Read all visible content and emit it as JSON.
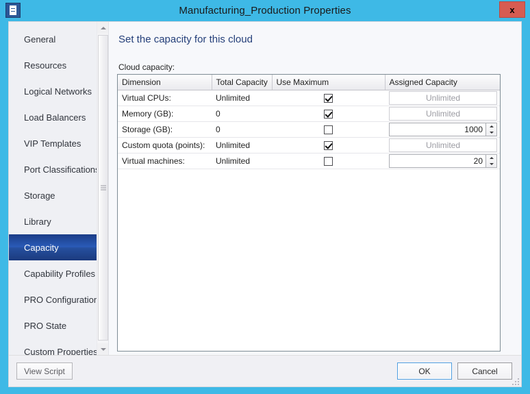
{
  "window": {
    "title": "Manufacturing_Production Properties",
    "icon": "properties-icon",
    "close_label": "x"
  },
  "sidebar": {
    "items": [
      {
        "label": "General",
        "selected": false
      },
      {
        "label": "Resources",
        "selected": false
      },
      {
        "label": "Logical Networks",
        "selected": false
      },
      {
        "label": "Load Balancers",
        "selected": false
      },
      {
        "label": "VIP Templates",
        "selected": false
      },
      {
        "label": "Port Classifications",
        "selected": false
      },
      {
        "label": "Storage",
        "selected": false
      },
      {
        "label": "Library",
        "selected": false
      },
      {
        "label": "Capacity",
        "selected": true
      },
      {
        "label": "Capability Profiles",
        "selected": false
      },
      {
        "label": "PRO Configuration",
        "selected": false
      },
      {
        "label": "PRO State",
        "selected": false
      },
      {
        "label": "Custom Properties",
        "selected": false
      }
    ]
  },
  "content": {
    "page_title": "Set the capacity for this cloud",
    "field_label": "Cloud capacity:",
    "table": {
      "columns": [
        "Dimension",
        "Total Capacity",
        "Use Maximum",
        "Assigned Capacity"
      ],
      "rows": [
        {
          "dimension": "Virtual CPUs:",
          "total_capacity": "Unlimited",
          "use_maximum": true,
          "assigned_capacity": "Unlimited",
          "assigned_editable": false
        },
        {
          "dimension": "Memory (GB):",
          "total_capacity": "0",
          "use_maximum": true,
          "assigned_capacity": "Unlimited",
          "assigned_editable": false
        },
        {
          "dimension": "Storage (GB):",
          "total_capacity": "0",
          "use_maximum": false,
          "assigned_capacity": "1000",
          "assigned_editable": true
        },
        {
          "dimension": "Custom quota (points):",
          "total_capacity": "Unlimited",
          "use_maximum": true,
          "assigned_capacity": "Unlimited",
          "assigned_editable": false
        },
        {
          "dimension": "Virtual machines:",
          "total_capacity": "Unlimited",
          "use_maximum": false,
          "assigned_capacity": "20",
          "assigned_editable": true
        }
      ]
    }
  },
  "footer": {
    "view_script": "View Script",
    "ok": "OK",
    "cancel": "Cancel"
  },
  "colors": {
    "window_border": "#3eb9e6",
    "title_accent": "#25407a",
    "selected_nav": "#1b3d87",
    "close_button": "#d65c52",
    "focus_border": "#4f9ee0"
  }
}
